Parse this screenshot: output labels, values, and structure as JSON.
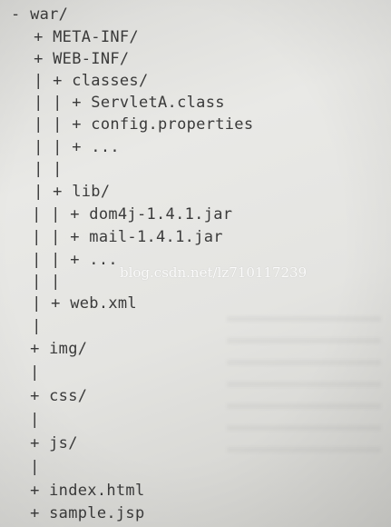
{
  "tree": {
    "lines": [
      "- war/",
      "  + META-INF/",
      "  + WEB-INF/",
      "  | + classes/",
      "  | | + ServletA.class",
      "  | | + config.properties",
      "  | | + ...",
      "  | |",
      "  | + lib/",
      "  | | + dom4j-1.4.1.jar",
      "  | | + mail-1.4.1.jar",
      "  | | + ...",
      "  | |",
      "  | + web.xml",
      "  |",
      "  + img/",
      "  |",
      "  + css/",
      "  |",
      "  + js/",
      "  |",
      "  + index.html",
      "  + sample.jsp"
    ]
  },
  "watermark": "blog.csdn.net/lz710117239"
}
